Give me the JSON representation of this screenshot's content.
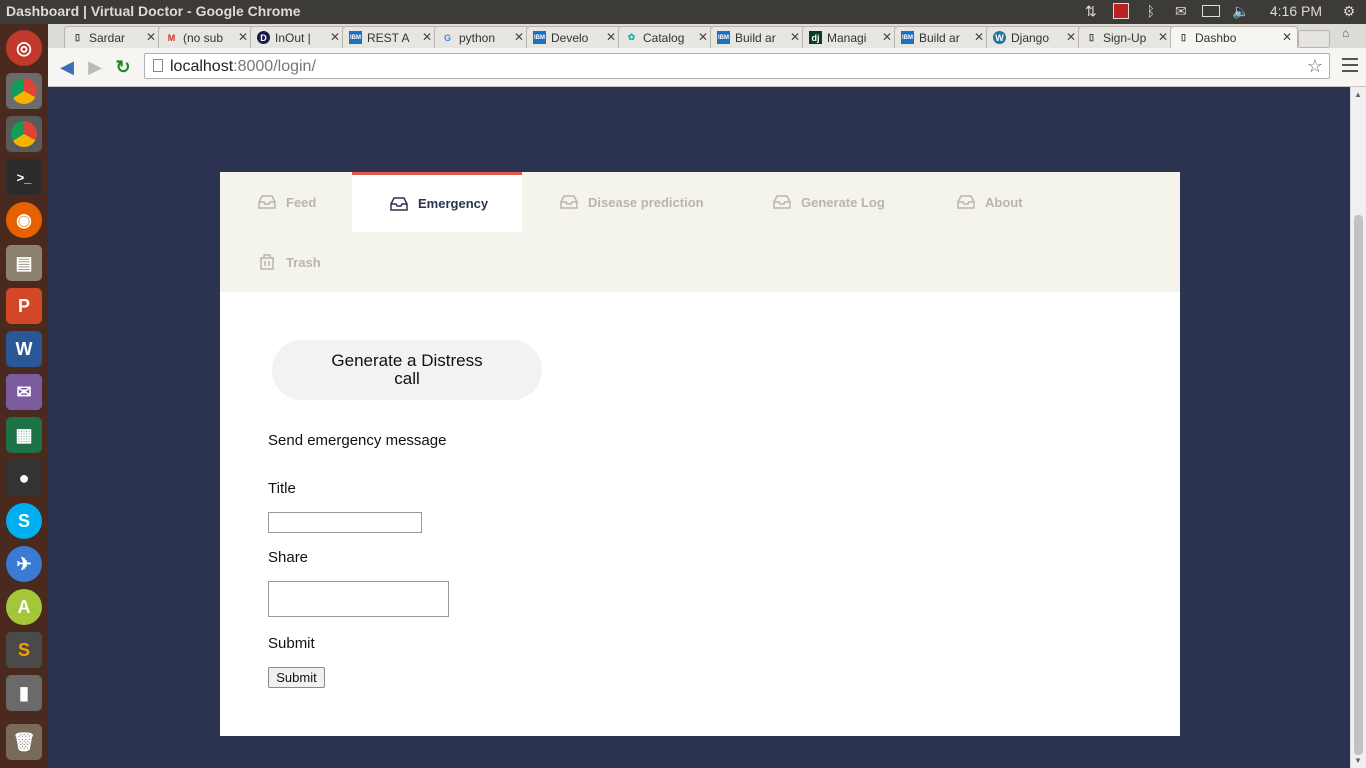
{
  "window": {
    "title": "Dashboard | Virtual Doctor - Google Chrome",
    "clock": "4:16 PM"
  },
  "launcher": {
    "items": [
      "ubuntu-dash",
      "chromium",
      "google-chrome",
      "terminal",
      "firefox",
      "file-manager",
      "wps-presentation",
      "wps-writer",
      "pidgin",
      "spreadsheet",
      "system-info",
      "skype",
      "browser",
      "android-studio",
      "sublime-text",
      "media-player",
      "trash"
    ]
  },
  "tabs": [
    {
      "label": "Sardar",
      "favicon": "page-icon"
    },
    {
      "label": "(no sub",
      "favicon": "gmail-icon"
    },
    {
      "label": "InOut |",
      "favicon": "d-icon"
    },
    {
      "label": "REST A",
      "favicon": "ibm-icon"
    },
    {
      "label": "python",
      "favicon": "google-icon"
    },
    {
      "label": "Develo",
      "favicon": "ibm-icon"
    },
    {
      "label": "Catalog",
      "favicon": "catalog-icon"
    },
    {
      "label": "Build ar",
      "favicon": "ibm-icon"
    },
    {
      "label": "Managi",
      "favicon": "django-icon"
    },
    {
      "label": "Build ar",
      "favicon": "ibm-icon"
    },
    {
      "label": "Django",
      "favicon": "wordpress-icon"
    },
    {
      "label": "Sign-Up",
      "favicon": "page-icon"
    },
    {
      "label": "Dashbo",
      "favicon": "page-icon"
    }
  ],
  "toolbar": {
    "url_host": "localhost",
    "url_rest": ":8000/login/"
  },
  "nav": {
    "feed": "Feed",
    "emergency": "Emergency",
    "disease": "Disease prediction",
    "log": "Generate Log",
    "about": "About",
    "trash": "Trash"
  },
  "main": {
    "distress_button": "Generate a Distress call",
    "send_heading": "Send emergency message",
    "title_label": "Title",
    "title_value": "",
    "share_label": "Share",
    "share_value": "",
    "submit_label": "Submit",
    "submit_button": "Submit"
  },
  "colors": {
    "page_bg": "#2b3350",
    "tab_accent": "#e05a4c",
    "tabs_bg": "#f4f3ec"
  }
}
